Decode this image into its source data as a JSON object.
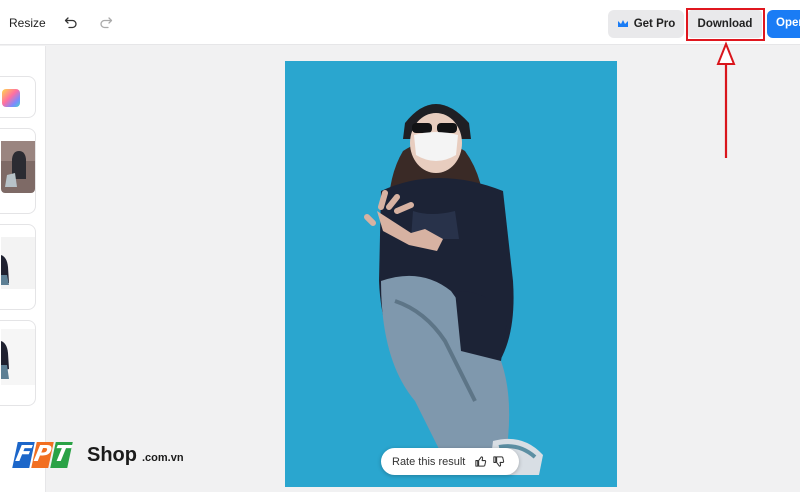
{
  "toolbar": {
    "resize_label": "Resize",
    "undo_icon": "undo-icon",
    "redo_icon": "redo-icon",
    "get_pro_label": "Get Pro",
    "get_pro_icon": "crown-icon",
    "download_label": "Download",
    "open_label": "Open"
  },
  "sidebar": {
    "items": [
      {
        "name": "background-color-option",
        "icon": "rainbow-icon"
      },
      {
        "name": "photo-thumbnail-1"
      },
      {
        "name": "photo-thumbnail-2"
      },
      {
        "name": "photo-thumbnail-3"
      }
    ]
  },
  "canvas": {
    "background_color": "#2aa6cf",
    "rate_label": "Rate this result",
    "thumbs_up_icon": "thumbs-up-icon",
    "thumbs_down_icon": "thumbs-down-icon"
  },
  "annotation": {
    "highlight_color": "#e0171f",
    "arrow_icon": "arrow-up-icon"
  },
  "watermark": {
    "letters": [
      "F",
      "P",
      "T"
    ],
    "brand": "Shop",
    "domain": ".com.vn"
  },
  "colors": {
    "accent": "#1a7cf5",
    "fpt_blue": "#1c66c9",
    "fpt_orange": "#f26f21",
    "fpt_green": "#2aa246"
  }
}
